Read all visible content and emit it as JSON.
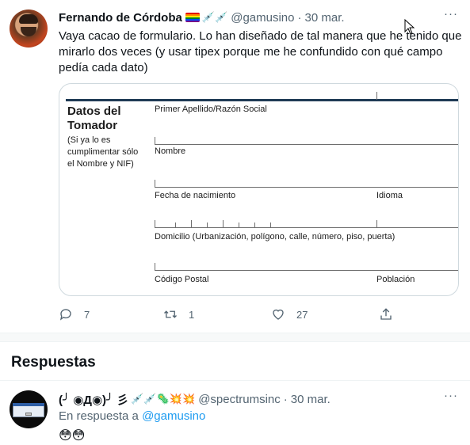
{
  "tweet": {
    "author_name": "Fernando de Córdoba",
    "author_emojis": "💉💉",
    "handle": "@gamusino",
    "separator": "·",
    "time": "30 mar.",
    "text": "Vaya cacao de formulario. Lo han diseñado de tal manera que he tenido que mirarlo dos veces (y usar tipex porque me he confundido con qué campo pedía cada dato)",
    "more_icon": "more-icon",
    "actions": {
      "replies": "7",
      "retweets": "1",
      "likes": "27"
    }
  },
  "form_image": {
    "title": "Datos del Tomador",
    "subtitle": "(Si ya lo es cumplimentar sólo el Nombre y NIF)",
    "labels": {
      "surname": "Primer Apellido/Razón Social",
      "name": "Nombre",
      "birth": "Fecha de nacimiento",
      "language": "Idioma",
      "address": "Domicilio (Urbanización, polígono, calle, número, piso, puerta)",
      "postal": "Código Postal",
      "city": "Población"
    }
  },
  "replies_section": {
    "title": "Respuestas"
  },
  "reply": {
    "author_name": "(╯ ◉Д◉)╯ 彡",
    "author_emojis": "💉💉🦠💥💥",
    "handle": "@spectrumsinc",
    "separator": "·",
    "time": "30 mar.",
    "in_reply_prefix": "En respuesta a",
    "in_reply_mention": "@gamusino",
    "text": "😳😳"
  },
  "colors": {
    "accent": "#1d9bf0",
    "secondary_text": "#536471",
    "primary_text": "#0f1419"
  }
}
